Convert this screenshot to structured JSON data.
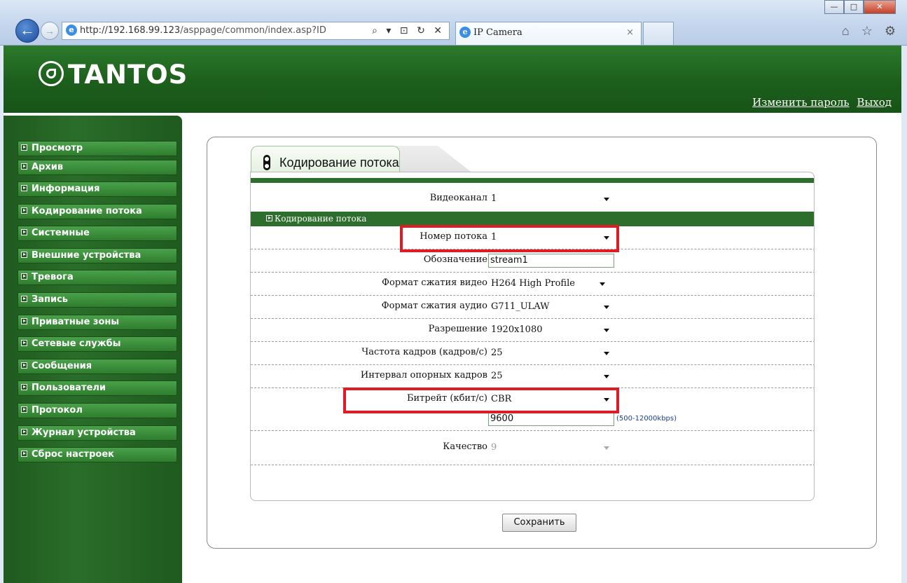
{
  "browser": {
    "url_host": "http://192.168.99.123",
    "url_path": "/asppage/common/index.asp?ID",
    "tab_title": "IP Camera",
    "tab_close": "×",
    "back_glyph": "←",
    "fwd_glyph": "→",
    "addr_tools": "⌕ ▾ ⊡ ↻ ✕",
    "win_min": "—",
    "win_max": "□",
    "win_close": "✕",
    "toolbar_icons": "⌂ ☆ ⚙"
  },
  "header": {
    "logo": "TANTOS",
    "change_password": "Изменить пароль",
    "logout": "Выход"
  },
  "sidebar": {
    "items": [
      {
        "label": "Просмотр"
      },
      {
        "label": "Архив"
      },
      {
        "label": "Информация"
      },
      {
        "label": "Кодирование потока"
      },
      {
        "label": "Системные"
      },
      {
        "label": "Внешние устройства"
      },
      {
        "label": "Тревога"
      },
      {
        "label": "Запись"
      },
      {
        "label": "Приватные зоны"
      },
      {
        "label": "Сетевые службы"
      },
      {
        "label": "Сообщения"
      },
      {
        "label": "Пользователи"
      },
      {
        "label": "Протокол"
      },
      {
        "label": "Журнал устройства"
      },
      {
        "label": "Сброс настроек"
      }
    ]
  },
  "panel": {
    "tab_title": "Кодирование потока",
    "section_title": "Кодирование потока"
  },
  "form": {
    "video_channel": {
      "label": "Видеоканал",
      "value": "1"
    },
    "stream_number": {
      "label": "Номер потока",
      "value": "1"
    },
    "designation": {
      "label": "Обозначение",
      "value": "stream1"
    },
    "video_format": {
      "label": "Формат сжатия видео",
      "value": "H264 High Profile"
    },
    "audio_format": {
      "label": "Формат сжатия аудио",
      "value": "G711_ULAW"
    },
    "resolution": {
      "label": "Разрешение",
      "value": "1920x1080"
    },
    "frame_rate": {
      "label": "Частота кадров (кадров/с)",
      "value": "25"
    },
    "gop": {
      "label": "Интервал опорных кадров",
      "value": "25"
    },
    "bitrate_mode": {
      "label": "Битрейт (кбит/с)",
      "value": "CBR"
    },
    "bitrate_value": {
      "value": "9600",
      "hint": "(500-12000kbps)"
    },
    "quality": {
      "label": "Качество",
      "value": "9"
    }
  },
  "actions": {
    "save_label": "Сохранить"
  }
}
